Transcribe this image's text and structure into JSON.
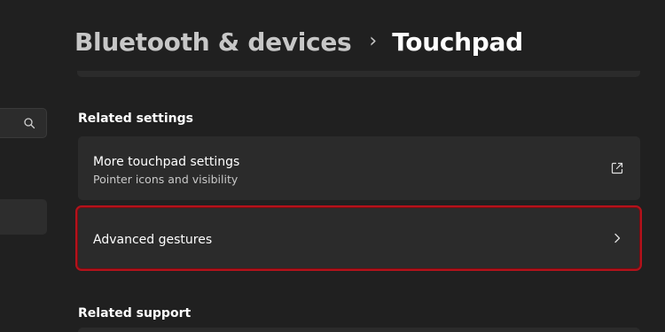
{
  "header": {
    "parent": "Bluetooth & devices",
    "separator": "›",
    "current": "Touchpad"
  },
  "sidebar": {
    "search_icon": "search-icon"
  },
  "related_settings": {
    "heading": "Related settings",
    "items": [
      {
        "title": "More touchpad settings",
        "subtitle": "Pointer icons and visibility",
        "icon": "external-link-icon"
      },
      {
        "title": "Advanced gestures",
        "icon": "chevron-right-icon",
        "highlighted": true
      }
    ]
  },
  "related_support": {
    "heading": "Related support"
  },
  "colors": {
    "background": "#202020",
    "card": "#2b2b2b",
    "highlight_border": "#b4121b"
  }
}
